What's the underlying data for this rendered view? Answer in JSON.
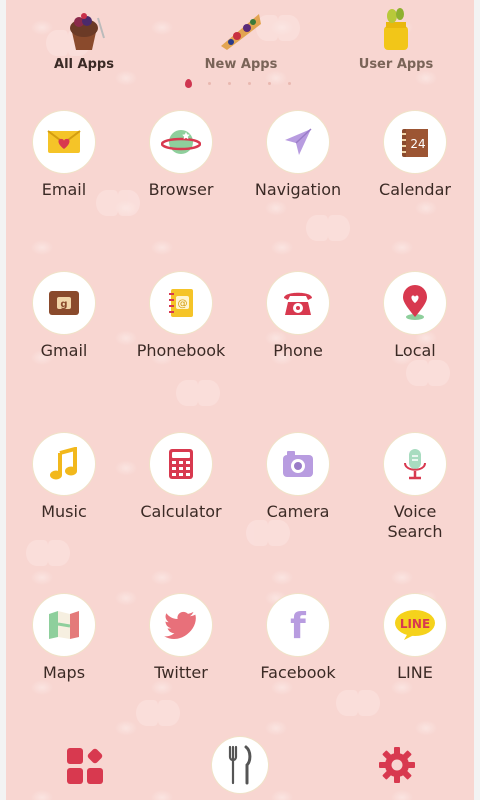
{
  "tabs": [
    {
      "label": "All Apps",
      "icon": "cupcake-icon",
      "active": true
    },
    {
      "label": "New Apps",
      "icon": "tart-slice-icon",
      "active": false
    },
    {
      "label": "User Apps",
      "icon": "lemon-jar-icon",
      "active": false
    }
  ],
  "page_indicator": {
    "pages": 6,
    "current": 1
  },
  "apps": [
    {
      "label": "Email",
      "icon": "envelope-heart-icon"
    },
    {
      "label": "Browser",
      "icon": "planet-icon"
    },
    {
      "label": "Navigation",
      "icon": "arrow-pointer-icon"
    },
    {
      "label": "Calendar",
      "icon": "calendar-icon",
      "badge": "24"
    },
    {
      "label": "Gmail",
      "icon": "gmail-g-icon",
      "badge": "g"
    },
    {
      "label": "Phonebook",
      "icon": "address-book-icon",
      "badge": "@"
    },
    {
      "label": "Phone",
      "icon": "rotary-phone-icon"
    },
    {
      "label": "Local",
      "icon": "map-pin-heart-icon"
    },
    {
      "label": "Music",
      "icon": "music-note-icon"
    },
    {
      "label": "Calculator",
      "icon": "calculator-icon"
    },
    {
      "label": "Camera",
      "icon": "camera-icon"
    },
    {
      "label": "Voice\nSearch",
      "icon": "microphone-icon"
    },
    {
      "label": "Maps",
      "icon": "folded-map-icon"
    },
    {
      "label": "Twitter",
      "icon": "bird-icon"
    },
    {
      "label": "Facebook",
      "icon": "facebook-f-icon",
      "badge": "f"
    },
    {
      "label": "LINE",
      "icon": "line-bubble-icon",
      "badge": "LINE"
    }
  ],
  "dock": {
    "left": "app-drawer-grid-icon",
    "center": "fork-knife-icon",
    "right": "gear-icon"
  },
  "colors": {
    "background": "#f8d6d1",
    "accent": "#d8394f",
    "text": "#3b2a25"
  }
}
